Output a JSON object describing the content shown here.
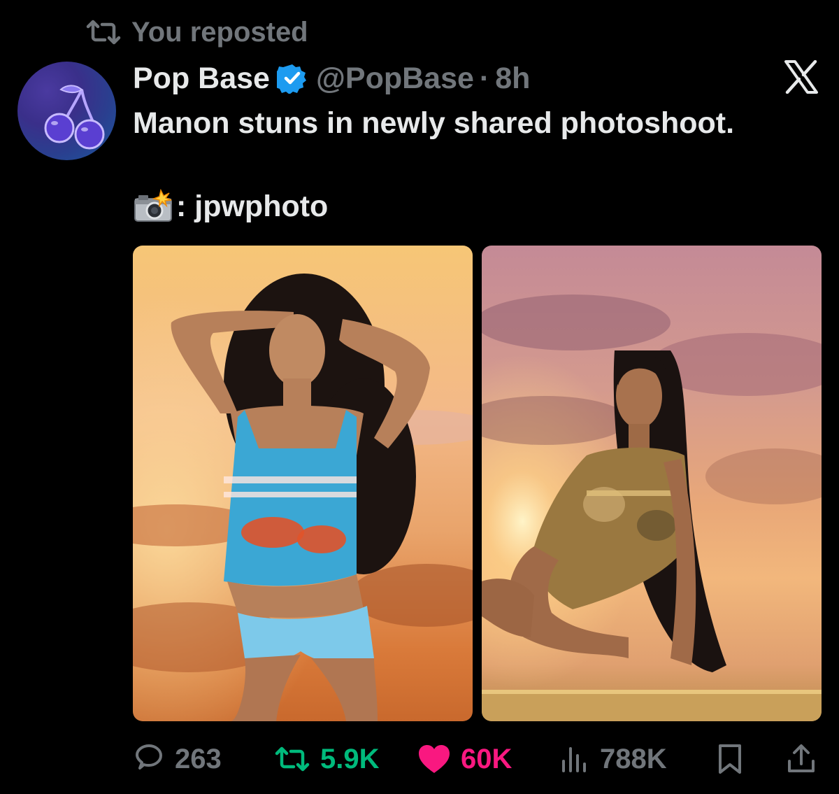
{
  "repost_banner": {
    "text": "You reposted",
    "icon": "repost-icon"
  },
  "author": {
    "name": "Pop Base",
    "handle": "@PopBase",
    "separator": "·",
    "time": "8h",
    "verified_icon": "verified-badge-icon",
    "avatar_icon": "cherries-icon"
  },
  "platform_logo": "x-logo-icon",
  "tweet": {
    "text_line_1": "Manon stuns in newly shared photoshoot.",
    "credit_emoji": "camera-with-flash-icon",
    "credit_text": ": jpwphoto"
  },
  "media": [
    {
      "name": "photo-woman-blue-top-sunset"
    },
    {
      "name": "photo-woman-long-hair-sunset"
    }
  ],
  "actions": {
    "reply_count": "263",
    "repost_count": "5.9K",
    "like_count": "60K",
    "views_count": "788K"
  },
  "colors": {
    "background": "#000000",
    "text_primary": "#e7e9ea",
    "text_secondary": "#71767b",
    "repost_active": "#00ba7c",
    "like_active": "#f91880",
    "verified": "#1d9bf0"
  }
}
